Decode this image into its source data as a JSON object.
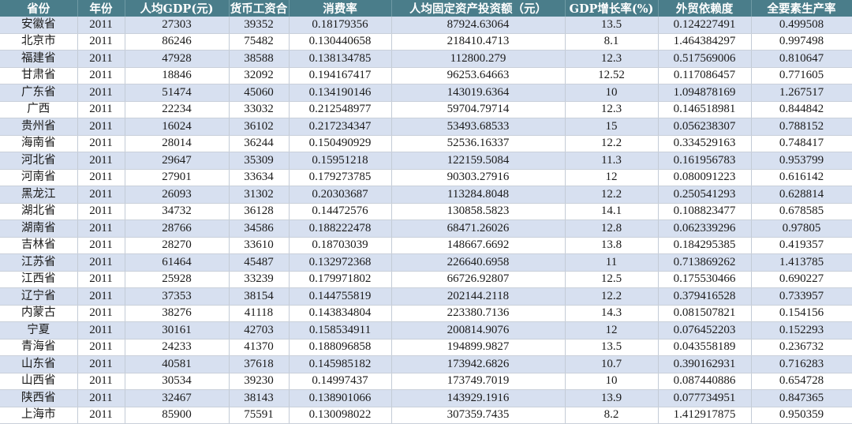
{
  "table": {
    "headers": [
      "省份",
      "年份",
      "人均GDP(元)",
      "货币工资合",
      "消费率",
      "人均固定资产投资额（元）",
      "GDP增长率(%)",
      "外贸依赖度",
      "全要素生产率"
    ],
    "rows": [
      [
        "安徽省",
        "2011",
        "27303",
        "39352",
        "0.18179356",
        "87924.63064",
        "13.5",
        "0.124227491",
        "0.499508"
      ],
      [
        "北京市",
        "2011",
        "86246",
        "75482",
        "0.130440658",
        "218410.4713",
        "8.1",
        "1.464384297",
        "0.997498"
      ],
      [
        "福建省",
        "2011",
        "47928",
        "38588",
        "0.138134785",
        "112800.279",
        "12.3",
        "0.517569006",
        "0.810647"
      ],
      [
        "甘肃省",
        "2011",
        "18846",
        "32092",
        "0.194167417",
        "96253.64663",
        "12.52",
        "0.117086457",
        "0.771605"
      ],
      [
        "广东省",
        "2011",
        "51474",
        "45060",
        "0.134190146",
        "143019.6364",
        "10",
        "1.094878169",
        "1.267517"
      ],
      [
        "广西",
        "2011",
        "22234",
        "33032",
        "0.212548977",
        "59704.79714",
        "12.3",
        "0.146518981",
        "0.844842"
      ],
      [
        "贵州省",
        "2011",
        "16024",
        "36102",
        "0.217234347",
        "53493.68533",
        "15",
        "0.056238307",
        "0.788152"
      ],
      [
        "海南省",
        "2011",
        "28014",
        "36244",
        "0.150490929",
        "52536.16337",
        "12.2",
        "0.334529163",
        "0.748417"
      ],
      [
        "河北省",
        "2011",
        "29647",
        "35309",
        "0.15951218",
        "122159.5084",
        "11.3",
        "0.161956783",
        "0.953799"
      ],
      [
        "河南省",
        "2011",
        "27901",
        "33634",
        "0.179273785",
        "90303.27916",
        "12",
        "0.080091223",
        "0.616142"
      ],
      [
        "黑龙江",
        "2011",
        "26093",
        "31302",
        "0.20303687",
        "113284.8048",
        "12.2",
        "0.250541293",
        "0.628814"
      ],
      [
        "湖北省",
        "2011",
        "34732",
        "36128",
        "0.14472576",
        "130858.5823",
        "14.1",
        "0.108823477",
        "0.678585"
      ],
      [
        "湖南省",
        "2011",
        "28766",
        "34586",
        "0.188222478",
        "68471.26026",
        "12.8",
        "0.062339296",
        "0.97805"
      ],
      [
        "吉林省",
        "2011",
        "28270",
        "33610",
        "0.18703039",
        "148667.6692",
        "13.8",
        "0.184295385",
        "0.419357"
      ],
      [
        "江苏省",
        "2011",
        "61464",
        "45487",
        "0.132972368",
        "226640.6958",
        "11",
        "0.713869262",
        "1.413785"
      ],
      [
        "江西省",
        "2011",
        "25928",
        "33239",
        "0.179971802",
        "66726.92807",
        "12.5",
        "0.175530466",
        "0.690227"
      ],
      [
        "辽宁省",
        "2011",
        "37353",
        "38154",
        "0.144755819",
        "202144.2118",
        "12.2",
        "0.379416528",
        "0.733957"
      ],
      [
        "内蒙古",
        "2011",
        "38276",
        "41118",
        "0.143834804",
        "223380.7136",
        "14.3",
        "0.081507821",
        "0.154156"
      ],
      [
        "宁夏",
        "2011",
        "30161",
        "42703",
        "0.158534911",
        "200814.9076",
        "12",
        "0.076452203",
        "0.152293"
      ],
      [
        "青海省",
        "2011",
        "24233",
        "41370",
        "0.188096858",
        "194899.9827",
        "13.5",
        "0.043558189",
        "0.236732"
      ],
      [
        "山东省",
        "2011",
        "40581",
        "37618",
        "0.145985182",
        "173942.6826",
        "10.7",
        "0.390162931",
        "0.716283"
      ],
      [
        "山西省",
        "2011",
        "30534",
        "39230",
        "0.14997437",
        "173749.7019",
        "10",
        "0.087440886",
        "0.654728"
      ],
      [
        "陕西省",
        "2011",
        "32467",
        "38143",
        "0.138901066",
        "143929.1916",
        "13.9",
        "0.077734951",
        "0.847365"
      ],
      [
        "上海市",
        "2011",
        "85900",
        "75591",
        "0.130098022",
        "307359.7435",
        "8.2",
        "1.412917875",
        "0.950359"
      ]
    ]
  }
}
